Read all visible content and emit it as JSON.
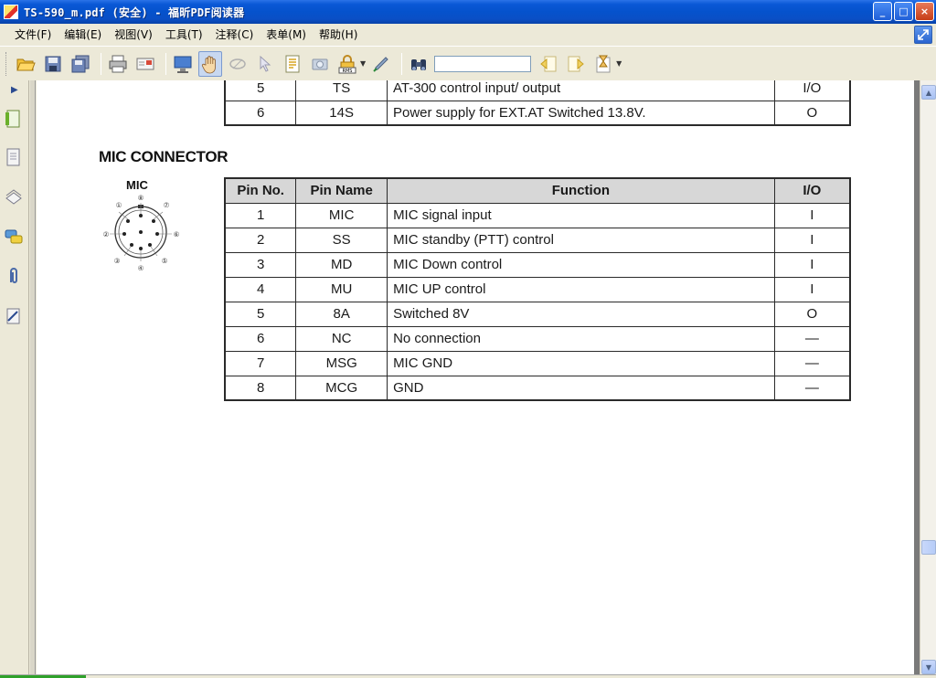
{
  "window": {
    "title": "TS-590_m.pdf (安全) - 福昕PDF阅读器",
    "controls": {
      "minimize": "_",
      "maximize": "□",
      "close": "×"
    }
  },
  "menu": [
    {
      "label": "文件(F)"
    },
    {
      "label": "编辑(E)"
    },
    {
      "label": "视图(V)"
    },
    {
      "label": "工具(T)"
    },
    {
      "label": "注释(C)"
    },
    {
      "label": "表单(M)"
    },
    {
      "label": "帮助(H)"
    }
  ],
  "toolbar": {
    "icons": [
      "open-folder-icon",
      "save-icon",
      "save-all-icon",
      "print-icon",
      "email-icon",
      "fullscreen-icon",
      "hand-tool-icon",
      "snapshot-select-icon",
      "select-cursor-icon",
      "text-select-icon",
      "camera-icon",
      "rms-lock-icon",
      "pen-icon",
      "binoculars-icon",
      "prev-result-icon",
      "next-result-icon",
      "hourglass-icon"
    ],
    "rms_label": "RMS",
    "search_value": ""
  },
  "document": {
    "top_table": {
      "rows": [
        {
          "pin": "5",
          "name": "TS",
          "function": "AT-300 control input/ output",
          "io": "I/O"
        },
        {
          "pin": "6",
          "name": "14S",
          "function": "Power supply for EXT.AT Switched 13.8V.",
          "io": "O"
        }
      ]
    },
    "section_title": "MIC CONNECTOR",
    "diagram": {
      "label": "MIC",
      "pins": [
        "①",
        "②",
        "③",
        "④",
        "⑤",
        "⑥",
        "⑦",
        "⑧"
      ]
    },
    "mic_table": {
      "headers": {
        "pin": "Pin No.",
        "name": "Pin Name",
        "function": "Function",
        "io": "I/O"
      },
      "rows": [
        {
          "pin": "1",
          "name": "MIC",
          "function": "MIC signal input",
          "io": "I"
        },
        {
          "pin": "2",
          "name": "SS",
          "function": "MIC standby (PTT) control",
          "io": "I"
        },
        {
          "pin": "3",
          "name": "MD",
          "function": "MIC Down control",
          "io": "I"
        },
        {
          "pin": "4",
          "name": "MU",
          "function": "MIC UP control",
          "io": "I"
        },
        {
          "pin": "5",
          "name": "8A",
          "function": "Switched 8V",
          "io": "O"
        },
        {
          "pin": "6",
          "name": "NC",
          "function": "No connection",
          "io": "—"
        },
        {
          "pin": "7",
          "name": "MSG",
          "function": "MIC GND",
          "io": "—"
        },
        {
          "pin": "8",
          "name": "MCG",
          "function": "GND",
          "io": "—"
        }
      ]
    }
  },
  "colors": {
    "titlebar": "#0552cc",
    "chrome": "#ece9d8",
    "table_header": "#d7d7d7"
  }
}
